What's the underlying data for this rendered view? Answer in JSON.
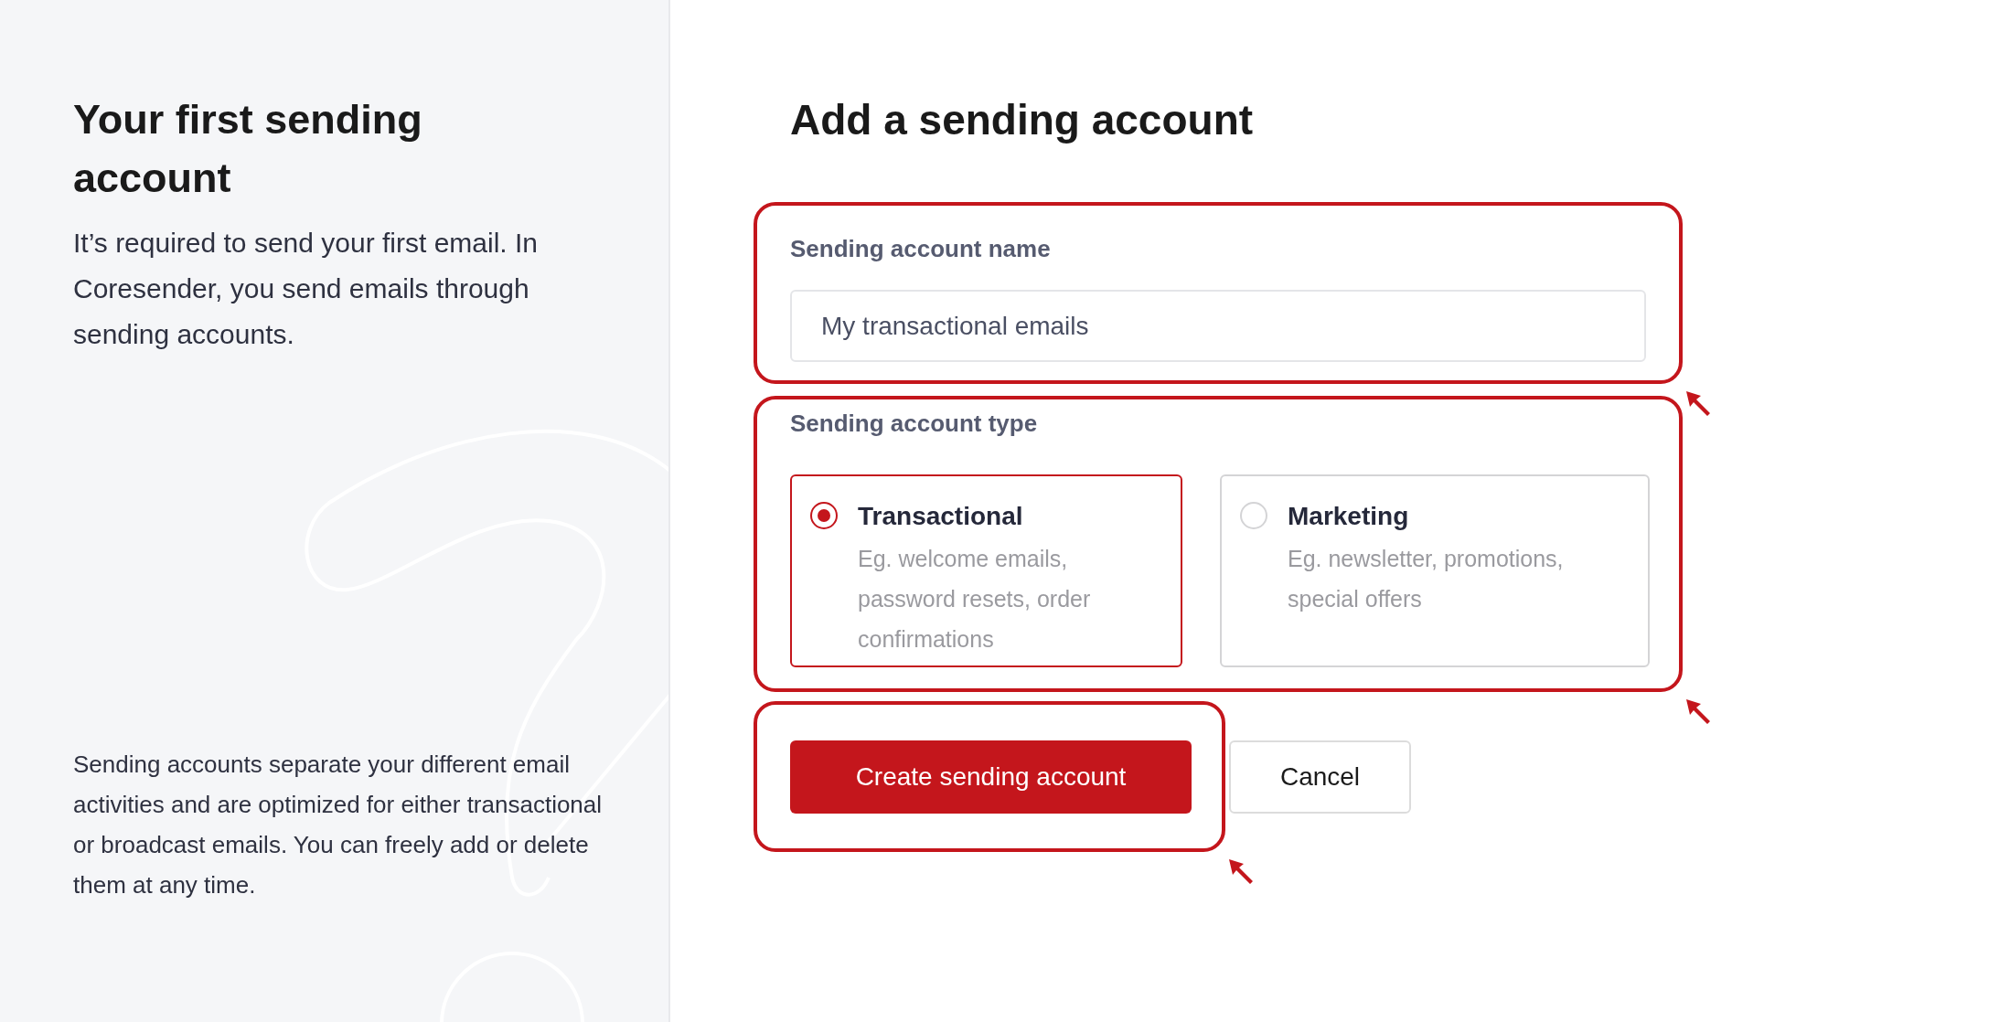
{
  "sidebar": {
    "title": "Your first sending account",
    "intro": "It’s required to send your first email. In Coresender, you send emails through sending accounts.",
    "note": "Sending accounts separate your different email activities and are optimized for either transactional or broadcast emails. You can freely add or delete them at any time."
  },
  "form": {
    "title": "Add a sending account",
    "name_field": {
      "label": "Sending account name",
      "value": "My transactional emails"
    },
    "type_field": {
      "label": "Sending account type",
      "options": [
        {
          "title": "Transactional",
          "description": "Eg. welcome emails, password resets, order confirmations",
          "selected": true
        },
        {
          "title": "Marketing",
          "description": "Eg. newsletter, promotions, special offers",
          "selected": false
        }
      ]
    },
    "buttons": [
      {
        "label": "Create sending account",
        "kind": "primary"
      },
      {
        "label": "Cancel",
        "kind": "secondary"
      }
    ]
  }
}
